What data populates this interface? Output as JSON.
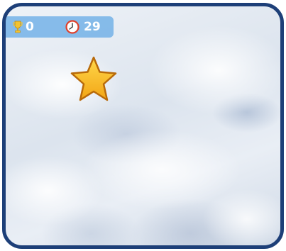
{
  "hud": {
    "score": "0",
    "time": "29"
  },
  "icons": {
    "score": "trophy-icon",
    "time": "clock-icon",
    "target": "star-icon"
  },
  "colors": {
    "frame": "#1d3f78",
    "hud_bar": "#64aae6",
    "star": "#f7b21f",
    "clock": "#e0402b"
  }
}
